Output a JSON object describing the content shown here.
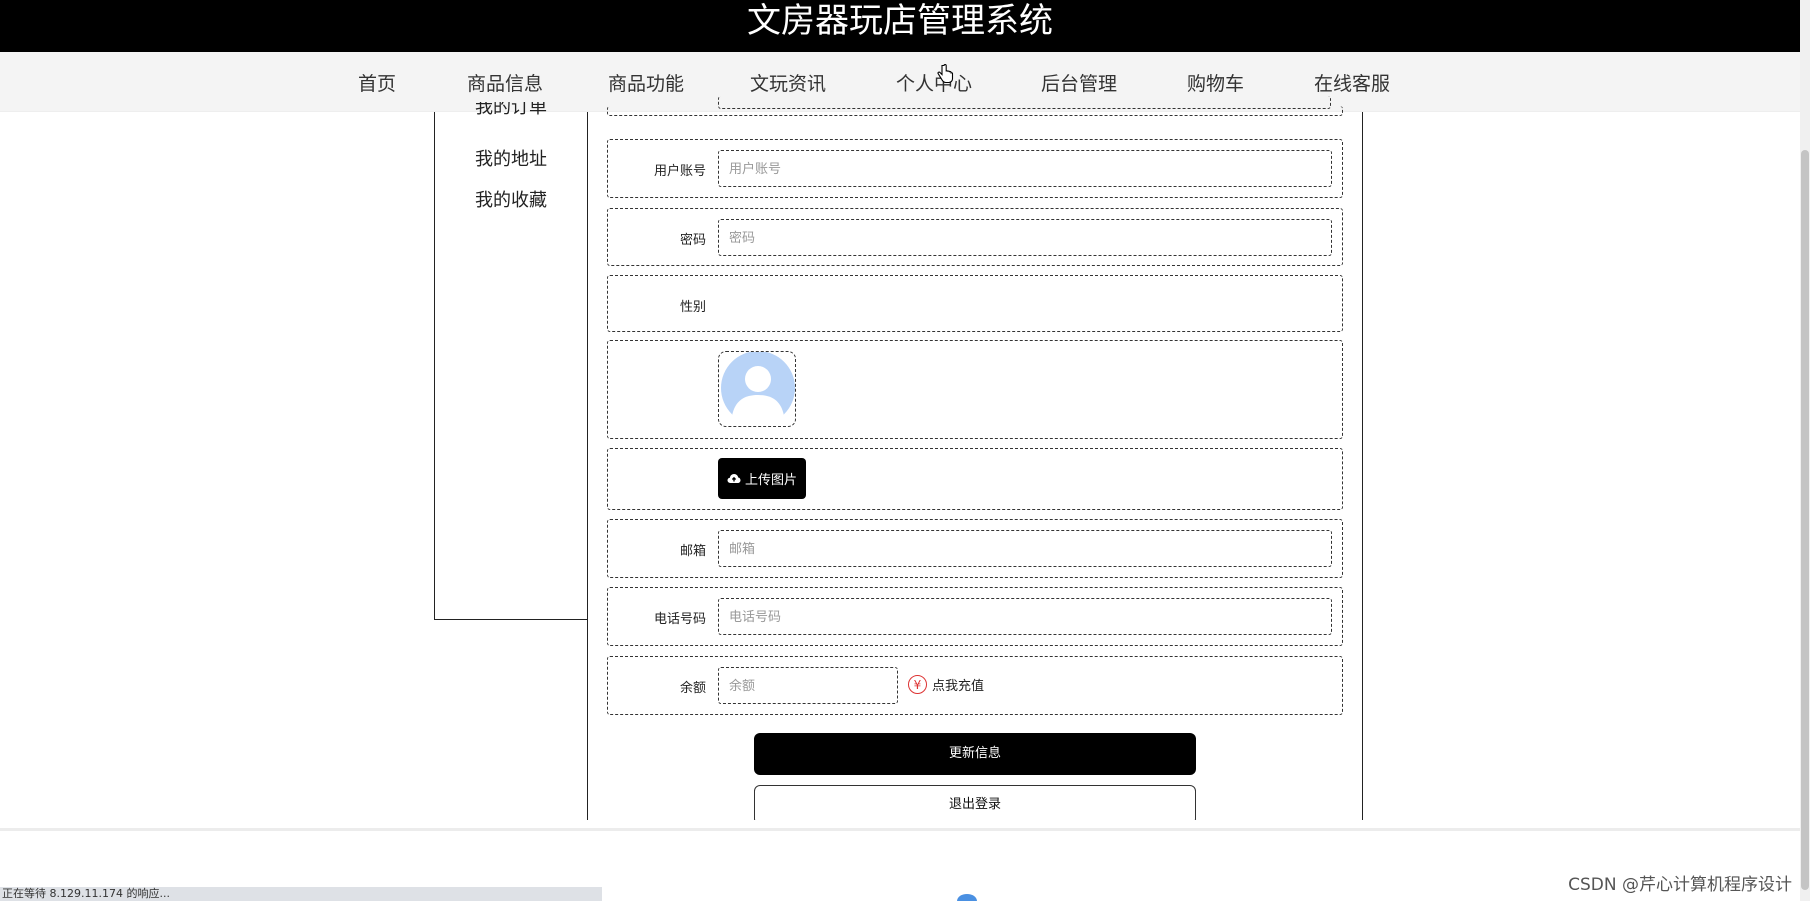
{
  "header": {
    "title": "文房器玩店管理系统"
  },
  "nav": {
    "items": [
      "首页",
      "商品信息",
      "商品功能",
      "文玩资讯",
      "个人中心",
      "后台管理",
      "购物车",
      "在线客服"
    ]
  },
  "sidebar": {
    "items": [
      "我的订单",
      "我的地址",
      "我的收藏"
    ]
  },
  "form": {
    "account_label": "用户账号",
    "account_placeholder": "用户账号",
    "password_label": "密码",
    "password_placeholder": "密码",
    "gender_label": "性别",
    "upload_label": "上传图片",
    "email_label": "邮箱",
    "email_placeholder": "邮箱",
    "phone_label": "电话号码",
    "phone_placeholder": "电话号码",
    "balance_label": "余额",
    "balance_placeholder": "余额",
    "recharge_label": "点我充值",
    "recharge_symbol": "¥"
  },
  "actions": {
    "update_label": "更新信息",
    "logout_label": "退出登录"
  },
  "status": {
    "text": "正在等待 8.129.11.174 的响应..."
  },
  "watermark": "CSDN @芹心计算机程序设计"
}
